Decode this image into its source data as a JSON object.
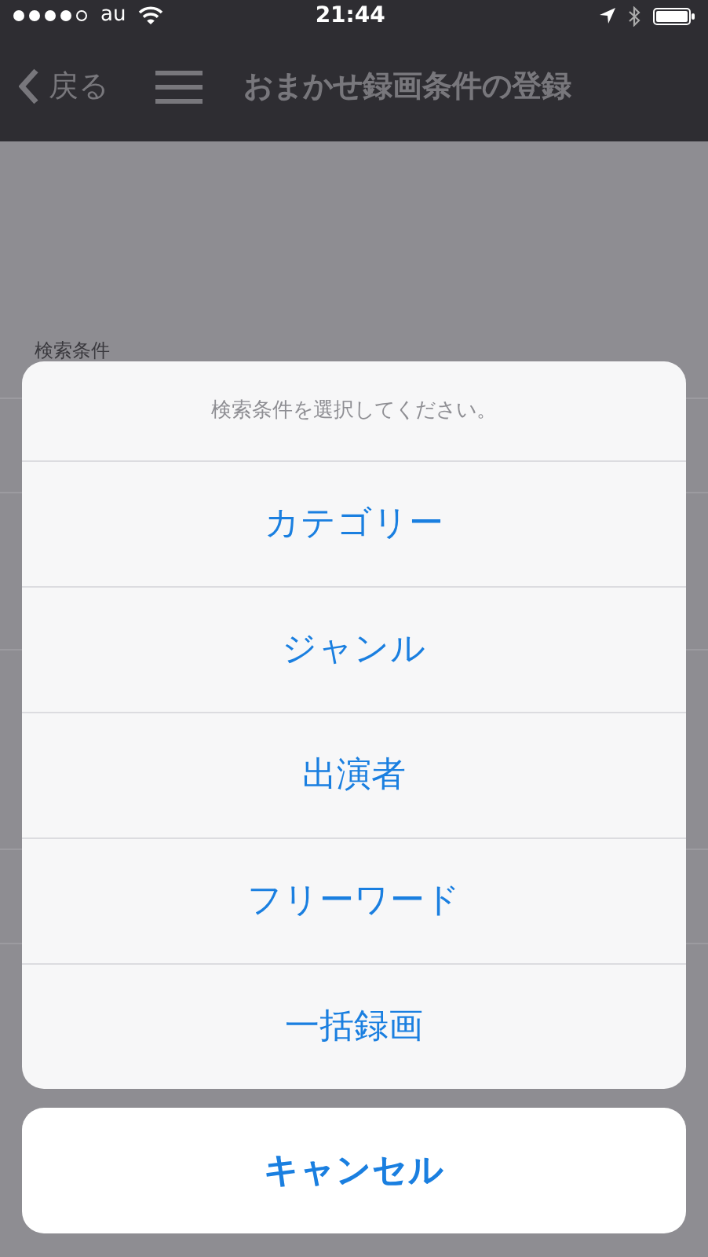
{
  "status_bar": {
    "carrier": "au",
    "time": "21:44"
  },
  "nav_bar": {
    "back": "戻る",
    "title": "おまかせ録画条件の登録"
  },
  "background": {
    "section_label": "検索条件"
  },
  "action_sheet": {
    "message": "検索条件を選択してください。",
    "options": [
      "カテゴリー",
      "ジャンル",
      "出演者",
      "フリーワード",
      "一括録画"
    ],
    "cancel": "キャンセル"
  }
}
